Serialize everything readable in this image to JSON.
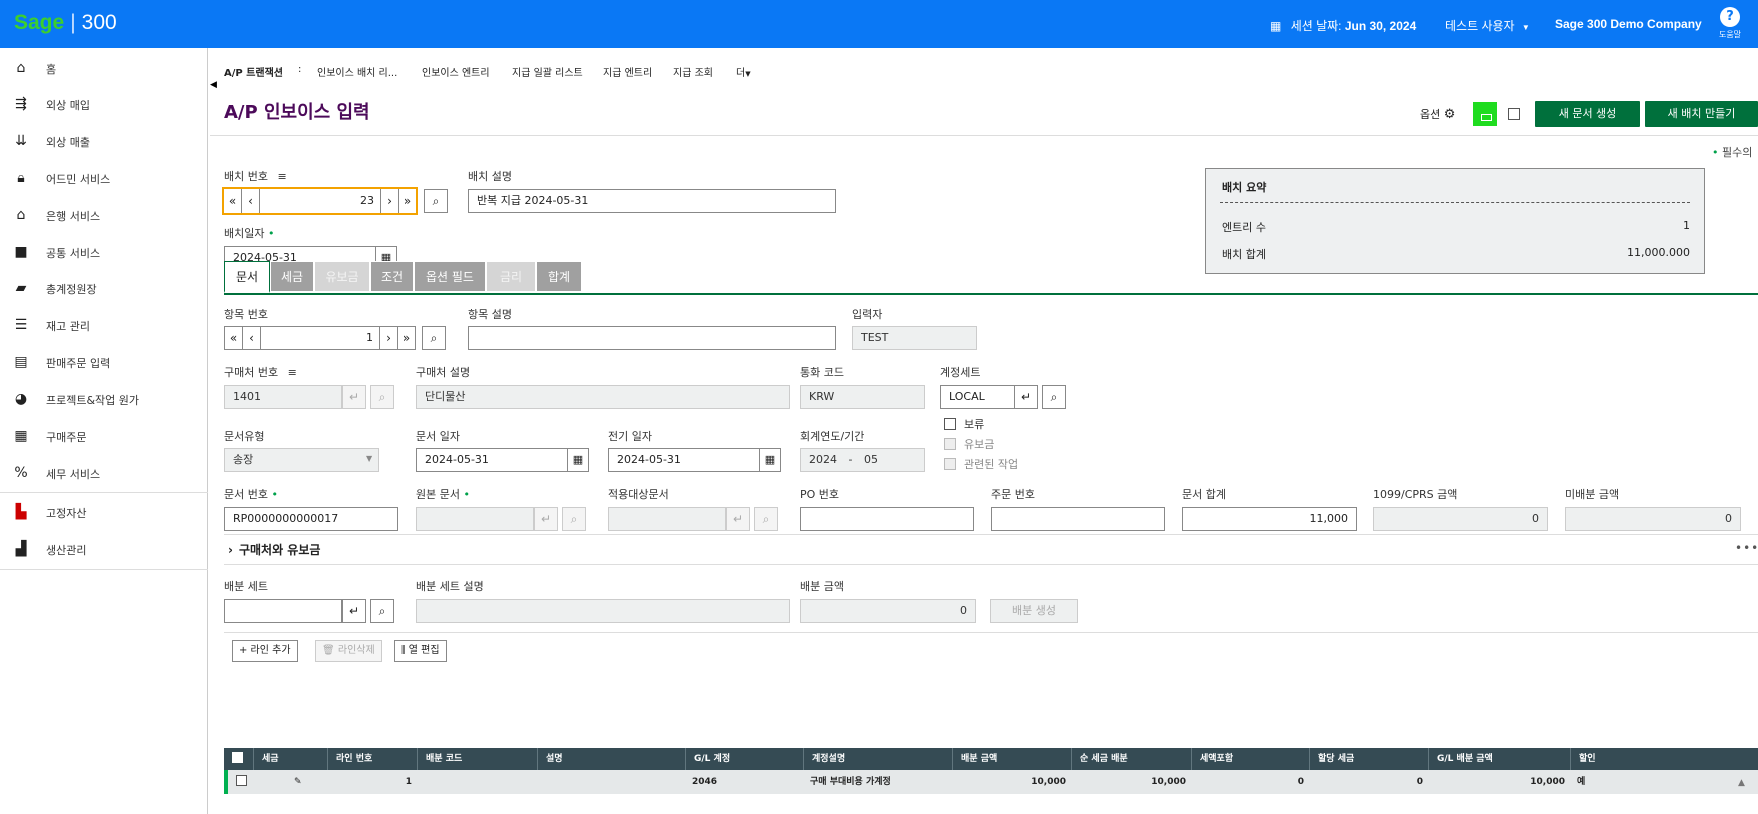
{
  "topbar": {
    "logo_sage": "Sage",
    "logo_sep": "|",
    "logo_num": "300",
    "session_label": "세션 날짜:",
    "session_date": "Jun 30, 2024",
    "user": "테스트 사용자",
    "company": "Sage 300 Demo Company",
    "help": "도움말"
  },
  "sidebar": {
    "items": [
      {
        "label": "홈",
        "icon": "home-icon"
      },
      {
        "label": "외상 매입",
        "icon": "ap-icon"
      },
      {
        "label": "외상 매출",
        "icon": "ar-icon"
      },
      {
        "label": "어드민 서비스",
        "icon": "lock-icon"
      },
      {
        "label": "은행 서비스",
        "icon": "bank-icon"
      },
      {
        "label": "공통 서비스",
        "icon": "briefcase-icon"
      },
      {
        "label": "총계정원장",
        "icon": "folder-icon"
      },
      {
        "label": "재고 관리",
        "icon": "inventory-icon"
      },
      {
        "label": "판매주문 입력",
        "icon": "order-icon"
      },
      {
        "label": "프로젝트&작업 원가",
        "icon": "pie-icon"
      },
      {
        "label": "구매주문",
        "icon": "table-icon"
      },
      {
        "label": "세무 서비스",
        "icon": "percent-icon"
      },
      {
        "label": "고정자산",
        "icon": "fixed-asset-icon"
      },
      {
        "label": "생산관리",
        "icon": "factory-icon"
      }
    ]
  },
  "breadcrumb": {
    "root": "A/P 트랜잭션",
    "sep": ":",
    "items": [
      "인보이스 배치 리...",
      "인보이스 엔트리",
      "지급 일괄 리스트",
      "지급 엔트리",
      "지급 조회"
    ],
    "more": "더"
  },
  "page": {
    "title": "A/P 인보이스 입력",
    "options": "옵션",
    "btn_new_doc": "새 문서 생성",
    "btn_new_batch": "새 배치 만들기",
    "required_note": "필수의"
  },
  "batch": {
    "number_label": "배치 번호",
    "number": "23",
    "desc_label": "배치 설명",
    "desc": "반복 지급 2024-05-31",
    "date_label": "배치일자",
    "date": "2024-05-31"
  },
  "summary": {
    "title": "배치 요약",
    "entries_label": "엔트리 수",
    "entries": "1",
    "total_label": "배치 합계",
    "total": "11,000.000"
  },
  "tabs": [
    {
      "label": "문서",
      "state": "active"
    },
    {
      "label": "세금",
      "state": "normal"
    },
    {
      "label": "유보금",
      "state": "disabled"
    },
    {
      "label": "조건",
      "state": "normal"
    },
    {
      "label": "옵션 필드",
      "state": "normal"
    },
    {
      "label": "금리",
      "state": "disabled"
    },
    {
      "label": "합계",
      "state": "normal"
    }
  ],
  "doc": {
    "entry_no_label": "항목 번호",
    "entry_no": "1",
    "entry_desc_label": "항목 설명",
    "entry_desc": "",
    "entered_by_label": "입력자",
    "entered_by": "TEST",
    "vendor_no_label": "구매처 번호",
    "vendor_no": "1401",
    "vendor_desc_label": "구매처 설명",
    "vendor_desc": "단디물산",
    "currency_label": "통화 코드",
    "currency": "KRW",
    "account_set_label": "계정세트",
    "account_set": "LOCAL",
    "hold_label": "보류",
    "retain_label": "유보금",
    "related_label": "관련된 작업",
    "doc_type_label": "문서유형",
    "doc_type": "송장",
    "doc_date_label": "문서 일자",
    "doc_date": "2024-05-31",
    "posting_date_label": "전기 일자",
    "posting_date": "2024-05-31",
    "fiscal_label": "회계연도/기간",
    "fiscal_year": "2024",
    "fiscal_dash": "-",
    "fiscal_period": "05",
    "doc_no_label": "문서 번호",
    "doc_no": "RP0000000000017",
    "orig_doc_label": "원본 문서",
    "orig_doc": "",
    "apply_doc_label": "적용대상문서",
    "apply_doc": "",
    "po_label": "PO 번호",
    "po": "",
    "order_label": "주문 번호",
    "order": "",
    "doc_total_label": "문서 합계",
    "doc_total": "11,000",
    "cprs_label": "1099/CPRS 금액",
    "cprs": "0",
    "undist_label": "미배분 금액",
    "undist": "0"
  },
  "vendor_section": {
    "title": "구매처와 유보금",
    "more": "•••"
  },
  "dist": {
    "set_label": "배분 세트",
    "set": "",
    "set_desc_label": "배분 세트 설명",
    "set_desc": "",
    "amount_label": "배분 금액",
    "amount": "0",
    "create_btn": "배분 생성"
  },
  "grid_toolbar": {
    "add": "+ 라인 추가",
    "delete": "라인삭제",
    "edit_cols": "열 편집"
  },
  "grid": {
    "columns": [
      "세금",
      "라인 번호",
      "배분 코드",
      "설명",
      "G/L 계정",
      "계정설명",
      "배분 금액",
      "순 세금 배분",
      "세액포함",
      "할당 세금",
      "G/L 배분 금액",
      "할인"
    ],
    "rows": [
      {
        "line": "1",
        "dist_code": "",
        "desc": "",
        "gl": "2046",
        "gl_desc": "구매 부대비용 가계정",
        "amount": "10,000",
        "net": "10,000",
        "incl": "0",
        "alloc": "0",
        "gl_amt": "10,000",
        "disc": "예"
      }
    ]
  },
  "colors": {
    "topbar": "#0a78f5",
    "brand_green": "#00703c",
    "accent_green": "#1fdc1f",
    "grid_header": "#354b54",
    "title": "#4c0a5a"
  }
}
